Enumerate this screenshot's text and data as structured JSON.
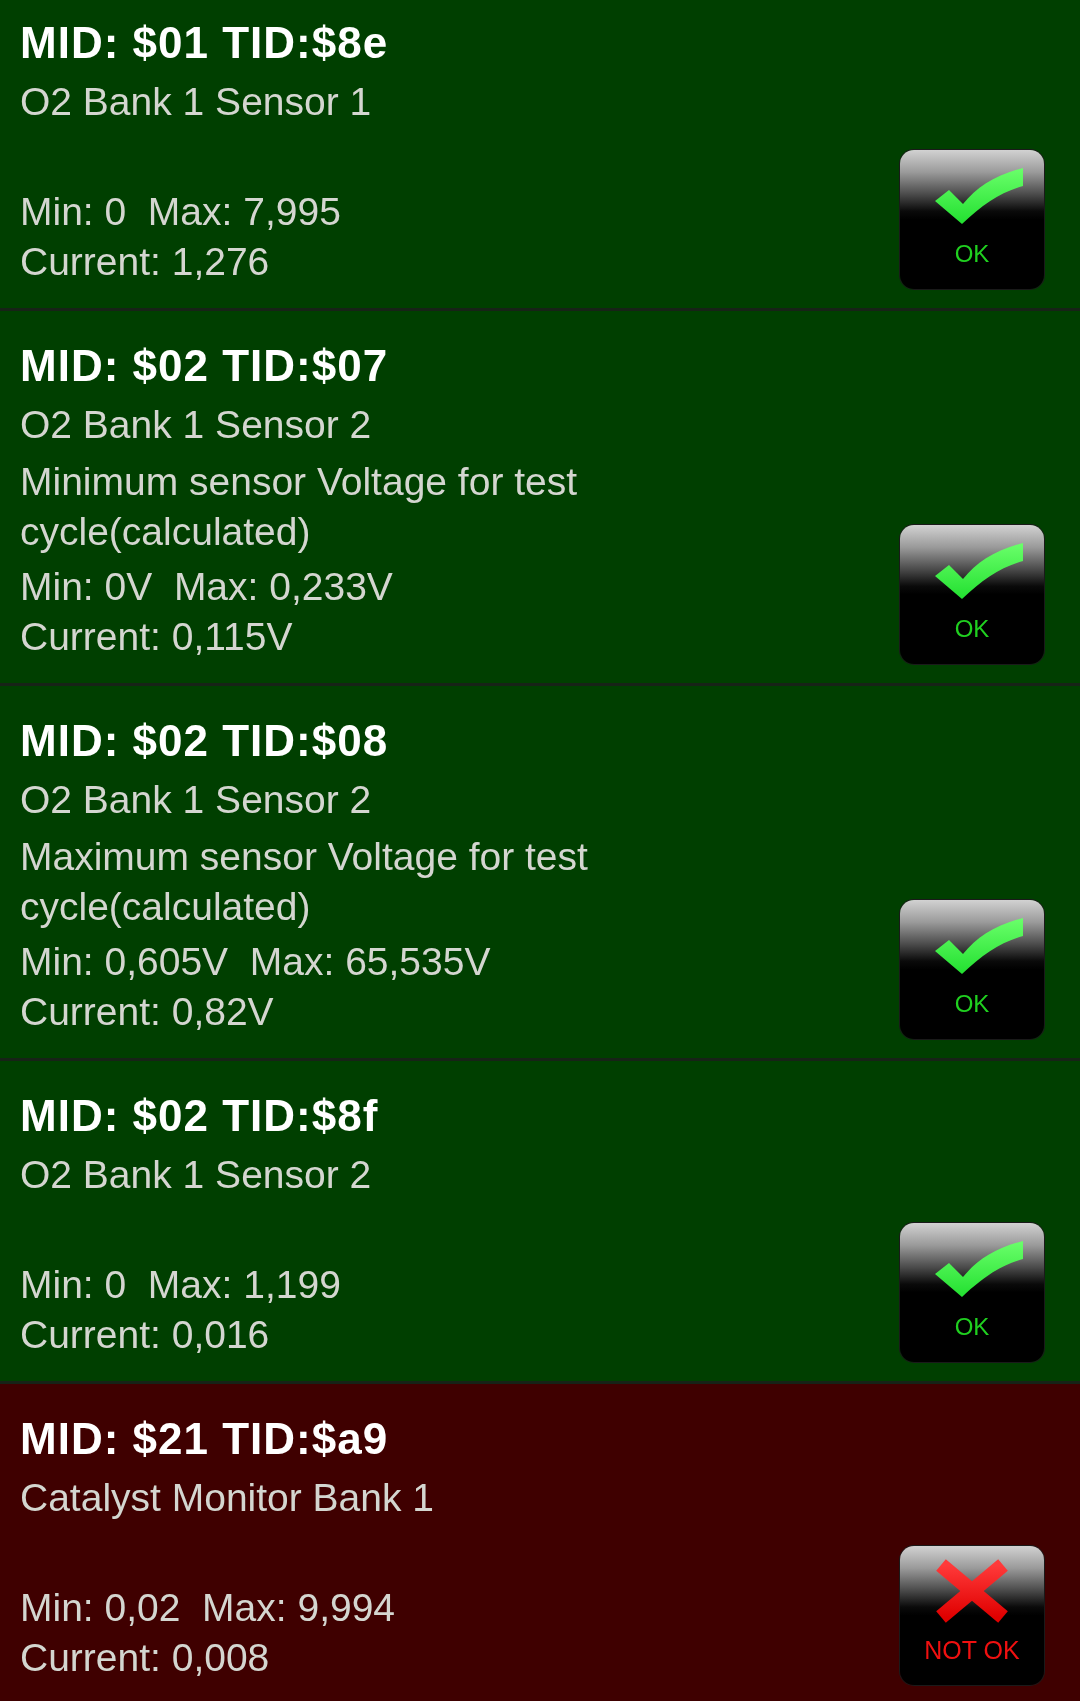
{
  "tests": [
    {
      "header": "MID: $01 TID:$8e",
      "name": "O2 Bank 1 Sensor 1",
      "limits": "Min: 0  Max: 7,995",
      "current": "Current: 1,276",
      "passed": true,
      "badge": "OK"
    },
    {
      "header": "MID: $02 TID:$07",
      "name": "O2 Bank 1 Sensor 2",
      "description": "Minimum sensor Voltage for test cycle(calculated)",
      "limits": "Min: 0V  Max: 0,233V",
      "current": "Current: 0,115V",
      "passed": true,
      "badge": "OK"
    },
    {
      "header": "MID: $02 TID:$08",
      "name": "O2 Bank 1 Sensor 2",
      "description": "Maximum sensor Voltage for test cycle(calculated)",
      "limits": "Min: 0,605V  Max: 65,535V",
      "current": "Current: 0,82V",
      "passed": true,
      "badge": "OK"
    },
    {
      "header": "MID: $02 TID:$8f",
      "name": "O2 Bank 1 Sensor 2",
      "limits": "Min: 0  Max: 1,199",
      "current": "Current: 0,016",
      "passed": true,
      "badge": "OK"
    },
    {
      "header": "MID: $21 TID:$a9",
      "name": "Catalyst Monitor Bank 1",
      "limits": "Min: 0,02  Max: 9,994",
      "current": "Current: 0,008",
      "passed": false,
      "badge": "NOT OK"
    }
  ]
}
